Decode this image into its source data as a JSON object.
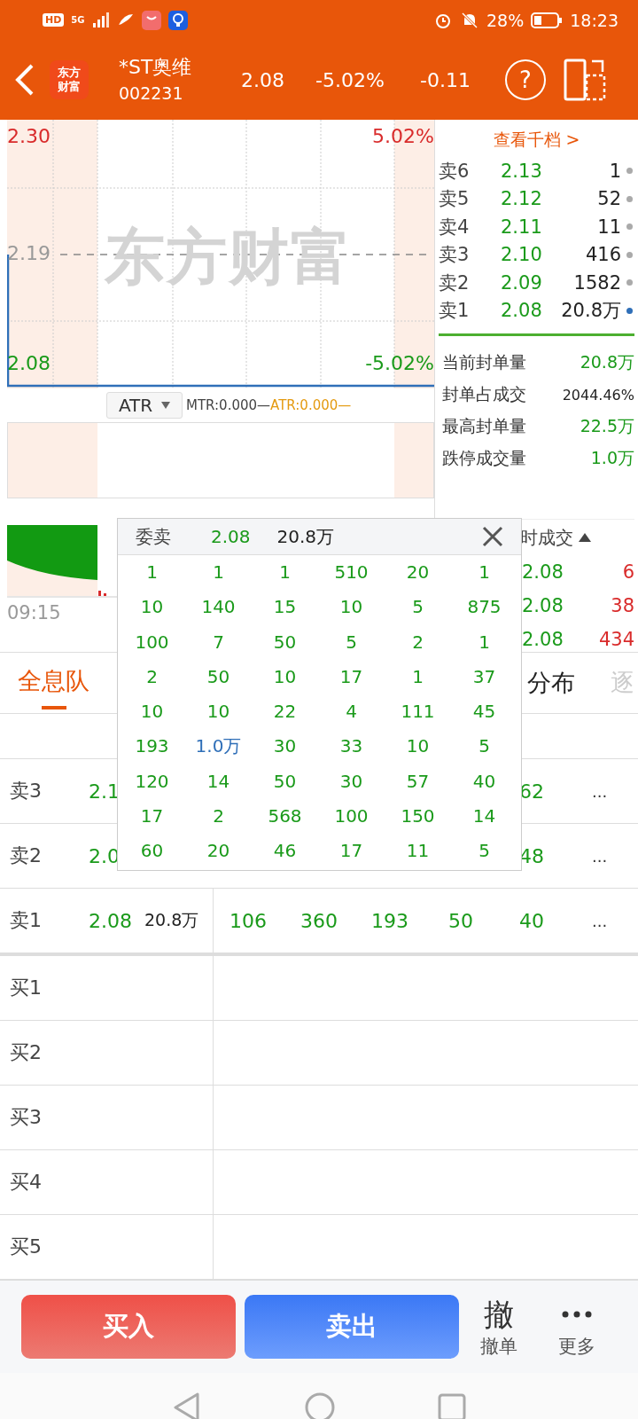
{
  "status_bar": {
    "hd": "HD",
    "network": "5G",
    "battery": "28%",
    "time": "18:23"
  },
  "header": {
    "logo": [
      "东方",
      "财富"
    ],
    "name": "*ST奥维",
    "code": "002231",
    "price": "2.08",
    "change_pct": "-5.02%",
    "change": "-0.11",
    "help": "?"
  },
  "chart": {
    "price_high": "2.30",
    "pct_high": "5.02%",
    "price_mid": "2.19",
    "price_low": "2.08",
    "pct_low": "-5.02%",
    "watermark": "东方财富"
  },
  "indicator": {
    "name": "ATR",
    "mtr": "MTR:0.000—",
    "atr": "ATR:0.000—"
  },
  "volume_time": "09:15",
  "order_book": {
    "link": "查看千档 >",
    "asks": [
      {
        "label": "卖6",
        "price": "2.13",
        "volume": "1",
        "color": "#aaaaaa"
      },
      {
        "label": "卖5",
        "price": "2.12",
        "volume": "52",
        "color": "#aaaaaa"
      },
      {
        "label": "卖4",
        "price": "2.11",
        "volume": "11",
        "color": "#aaaaaa"
      },
      {
        "label": "卖3",
        "price": "2.10",
        "volume": "416",
        "color": "#aaaaaa"
      },
      {
        "label": "卖2",
        "price": "2.09",
        "volume": "1582",
        "color": "#aaaaaa"
      },
      {
        "label": "卖1",
        "price": "2.08",
        "volume": "20.8万",
        "color": "#2f6fb8"
      }
    ],
    "stats": [
      {
        "label": "当前封单量",
        "value": "20.8万",
        "kind": "volume"
      },
      {
        "label": "封单占成交",
        "value": "2044.46%",
        "kind": "ratio"
      },
      {
        "label": "最高封单量",
        "value": "22.5万",
        "kind": "volume"
      },
      {
        "label": "跌停成交量",
        "value": "1.0万",
        "kind": "volume"
      }
    ]
  },
  "trades": {
    "header": "时成交",
    "rows": [
      {
        "price": "2.08",
        "volume": "6"
      },
      {
        "price": "2.08",
        "volume": "38"
      },
      {
        "price": "2.08",
        "volume": "434"
      }
    ]
  },
  "tabs": [
    {
      "label": "全息队",
      "selected": true,
      "faded": false
    },
    {
      "label": "分布",
      "selected": false,
      "faded": false
    },
    {
      "label": "逐",
      "selected": false,
      "faded": true
    }
  ],
  "queue": [
    {
      "label": "卖3",
      "price": "2.1",
      "orders": [
        "62"
      ],
      "more": "..."
    },
    {
      "label": "卖2",
      "price": "2.0",
      "orders": [
        "48"
      ],
      "more": "..."
    },
    {
      "label": "卖1",
      "price": "2.08",
      "volume": "20.8万",
      "orders": [
        "106",
        "360",
        "193",
        "50",
        "40"
      ],
      "more": "..."
    },
    {
      "label": "买1"
    },
    {
      "label": "买2"
    },
    {
      "label": "买3"
    },
    {
      "label": "买4"
    },
    {
      "label": "买5"
    }
  ],
  "popup": {
    "title": "委卖",
    "price": "2.08",
    "volume": "20.8万",
    "rows": [
      [
        {
          "t": "1",
          "big": false
        },
        {
          "t": "1",
          "big": false
        },
        {
          "t": "1",
          "big": false
        },
        {
          "t": "510",
          "big": false
        },
        {
          "t": "20",
          "big": false
        },
        {
          "t": "1",
          "big": false
        }
      ],
      [
        {
          "t": "10",
          "big": false
        },
        {
          "t": "140",
          "big": false
        },
        {
          "t": "15",
          "big": false
        },
        {
          "t": "10",
          "big": false
        },
        {
          "t": "5",
          "big": false
        },
        {
          "t": "875",
          "big": false
        }
      ],
      [
        {
          "t": "100",
          "big": false
        },
        {
          "t": "7",
          "big": false
        },
        {
          "t": "50",
          "big": false
        },
        {
          "t": "5",
          "big": false
        },
        {
          "t": "2",
          "big": false
        },
        {
          "t": "1",
          "big": false
        }
      ],
      [
        {
          "t": "2",
          "big": false
        },
        {
          "t": "50",
          "big": false
        },
        {
          "t": "10",
          "big": false
        },
        {
          "t": "17",
          "big": false
        },
        {
          "t": "1",
          "big": false
        },
        {
          "t": "37",
          "big": false
        }
      ],
      [
        {
          "t": "10",
          "big": false
        },
        {
          "t": "10",
          "big": false
        },
        {
          "t": "22",
          "big": false
        },
        {
          "t": "4",
          "big": false
        },
        {
          "t": "111",
          "big": false
        },
        {
          "t": "45",
          "big": false
        }
      ],
      [
        {
          "t": "193",
          "big": false
        },
        {
          "t": "1.0万",
          "big": true
        },
        {
          "t": "30",
          "big": false
        },
        {
          "t": "33",
          "big": false
        },
        {
          "t": "10",
          "big": false
        },
        {
          "t": "5",
          "big": false
        }
      ],
      [
        {
          "t": "120",
          "big": false
        },
        {
          "t": "14",
          "big": false
        },
        {
          "t": "50",
          "big": false
        },
        {
          "t": "30",
          "big": false
        },
        {
          "t": "57",
          "big": false
        },
        {
          "t": "40",
          "big": false
        }
      ],
      [
        {
          "t": "17",
          "big": false
        },
        {
          "t": "2",
          "big": false
        },
        {
          "t": "568",
          "big": false
        },
        {
          "t": "100",
          "big": false
        },
        {
          "t": "150",
          "big": false
        },
        {
          "t": "14",
          "big": false
        }
      ],
      [
        {
          "t": "60",
          "big": false
        },
        {
          "t": "20",
          "big": false
        },
        {
          "t": "46",
          "big": false
        },
        {
          "t": "17",
          "big": false
        },
        {
          "t": "11",
          "big": false
        },
        {
          "t": "5",
          "big": false
        }
      ]
    ]
  },
  "bottom": {
    "buy": "买入",
    "sell": "卖出",
    "cancel_glyph": "撤",
    "cancel": "撤单",
    "more": "更多"
  }
}
